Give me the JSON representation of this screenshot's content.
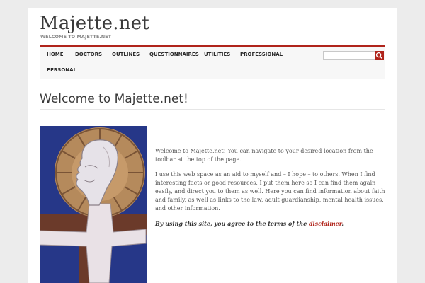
{
  "site": {
    "title": "Majette.net",
    "tagline": "WELCOME TO MAJETTE.NET"
  },
  "nav": {
    "items": [
      {
        "label": "HOME"
      },
      {
        "label": "DOCTORS"
      },
      {
        "label": "OUTLINES"
      },
      {
        "label": "QUESTIONNAIRES"
      },
      {
        "label": "UTILITIES"
      },
      {
        "label": "PROFESSIONAL"
      },
      {
        "label": "PERSONAL"
      }
    ],
    "search_value": ""
  },
  "page": {
    "title": "Welcome to Majette.net!",
    "intro": "Welcome to Majette.net! You can navigate to your desired location from the toolbar at the top of the page.",
    "body": "I use this web space as an aid to myself and – I hope – to others. When I find interesting facts or good resources, I put them here so I can find them again easily, and direct you to them as well. Here you can find information about faith and family, as well as links to the law, adult guardianship, mental health issues, and other information.",
    "agree_text": "By using this site, you agree to the terms of the ",
    "disclaimer_link": "disclaimer",
    "agree_end": "."
  },
  "colors": {
    "accent": "#b0241b",
    "text": "#555555",
    "heading": "#3a3a3a"
  },
  "icons": {
    "search": "search-icon"
  }
}
